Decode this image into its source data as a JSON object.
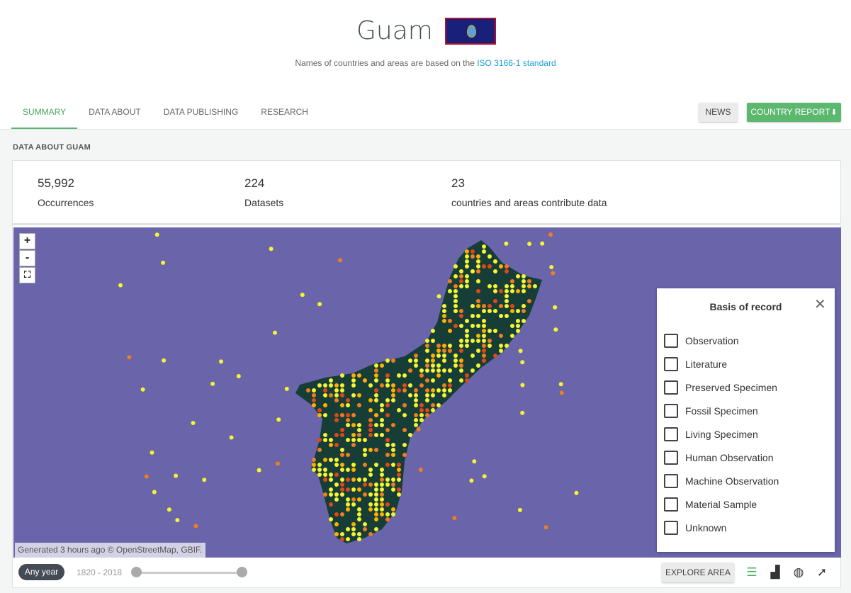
{
  "header": {
    "country_name": "Guam",
    "flag_icon": "guam-flag",
    "iso_note_prefix": "Names of countries and areas are based on the",
    "iso_link": "ISO 3166-1 standard"
  },
  "tabs": [
    {
      "label": "SUMMARY",
      "active": true
    },
    {
      "label": "DATA ABOUT",
      "active": false
    },
    {
      "label": "DATA PUBLISHING",
      "active": false
    },
    {
      "label": "RESEARCH",
      "active": false
    }
  ],
  "actions": {
    "news": "NEWS",
    "country_report": "COUNTRY REPORT",
    "download_icon": "download-icon"
  },
  "section_label": "DATA ABOUT GUAM",
  "stats": [
    {
      "value": "55,992",
      "label": "Occurrences"
    },
    {
      "value": "224",
      "label": "Datasets"
    },
    {
      "value": "23",
      "label": "countries and areas contribute data"
    }
  ],
  "map": {
    "zoom_in": "+",
    "zoom_out": "-",
    "attribution": "Generated 3 hours ago © OpenStreetMap, GBIF.",
    "colors": {
      "sea": "#6a64aa",
      "land": "#163d36",
      "low": "#f5f532",
      "mid": "#ffb000",
      "high": "#f07d1e",
      "peak": "#e0481a"
    }
  },
  "legend": {
    "title": "Basis of record",
    "close_icon": "close-icon",
    "items": [
      "Observation",
      "Literature",
      "Preserved Specimen",
      "Fossil Specimen",
      "Living Specimen",
      "Human Observation",
      "Machine Observation",
      "Material Sample",
      "Unknown"
    ]
  },
  "footer": {
    "any_year": "Any year",
    "year_range": "1820 - 2018",
    "explore_area": "EXPLORE AREA",
    "icons": [
      "sliders-icon",
      "paint-roller-icon",
      "globe-icon",
      "cursor-icon"
    ]
  }
}
